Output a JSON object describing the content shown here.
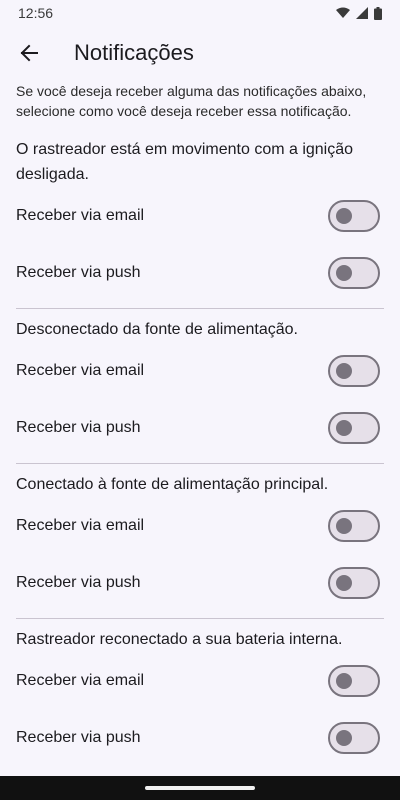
{
  "status_bar": {
    "time": "12:56"
  },
  "header": {
    "title": "Notificações"
  },
  "intro_text": "Se você deseja receber alguma das notificações abaixo, selecione como você deseja receber essa notificação.",
  "sections": [
    {
      "title": "O rastreador está em movimento com a ignição desligada.",
      "options": [
        {
          "label": "Receber via email",
          "enabled": false
        },
        {
          "label": "Receber via push",
          "enabled": false
        }
      ]
    },
    {
      "title": "Desconectado da fonte de alimentação.",
      "options": [
        {
          "label": "Receber via email",
          "enabled": false
        },
        {
          "label": "Receber via push",
          "enabled": false
        }
      ]
    },
    {
      "title": "Conectado à fonte de alimentação principal.",
      "options": [
        {
          "label": "Receber via email",
          "enabled": false
        },
        {
          "label": "Receber via push",
          "enabled": false
        }
      ]
    },
    {
      "title": "Rastreador reconectado a sua bateria interna.",
      "options": [
        {
          "label": "Receber via email",
          "enabled": false
        },
        {
          "label": "Receber via push",
          "enabled": false
        }
      ]
    }
  ]
}
